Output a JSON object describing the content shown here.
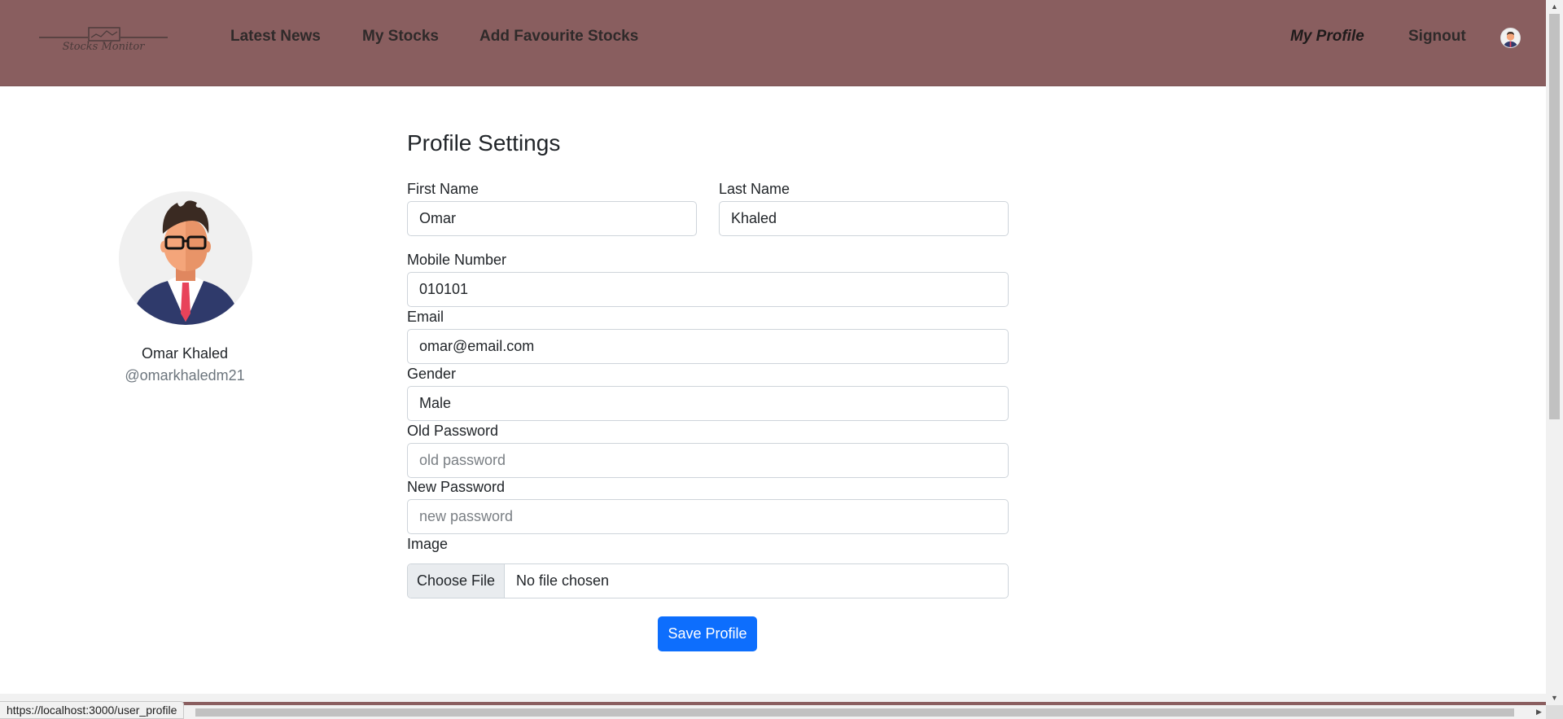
{
  "navbar": {
    "logo_text": "Stocks Monitor",
    "links": {
      "latest_news": "Latest News",
      "my_stocks": "My Stocks",
      "add_favourite": "Add Favourite Stocks",
      "my_profile": "My Profile",
      "signout": "Signout"
    },
    "background_color": "#895e5f"
  },
  "profile": {
    "full_name": "Omar Khaled",
    "username": "@omarkhaledm21"
  },
  "form": {
    "title": "Profile Settings",
    "first_name": {
      "label": "First Name",
      "value": "Omar"
    },
    "last_name": {
      "label": "Last Name",
      "value": "Khaled"
    },
    "mobile": {
      "label": "Mobile Number",
      "value": "010101"
    },
    "email": {
      "label": "Email",
      "value": "omar@email.com"
    },
    "gender": {
      "label": "Gender",
      "value": "Male"
    },
    "old_password": {
      "label": "Old Password",
      "placeholder": "old password"
    },
    "new_password": {
      "label": "New Password",
      "placeholder": "new password"
    },
    "image": {
      "label": "Image",
      "button_label": "Choose File",
      "status": "No file chosen"
    },
    "save_label": "Save Profile",
    "save_color": "#0d6efd"
  },
  "status_bar": {
    "url": "https://localhost:3000/user_profile"
  },
  "icons": {
    "logo": "stocks-chart-logo-icon",
    "nav_avatar": "user-avatar-icon",
    "profile_avatar": "businessman-avatar-icon"
  }
}
